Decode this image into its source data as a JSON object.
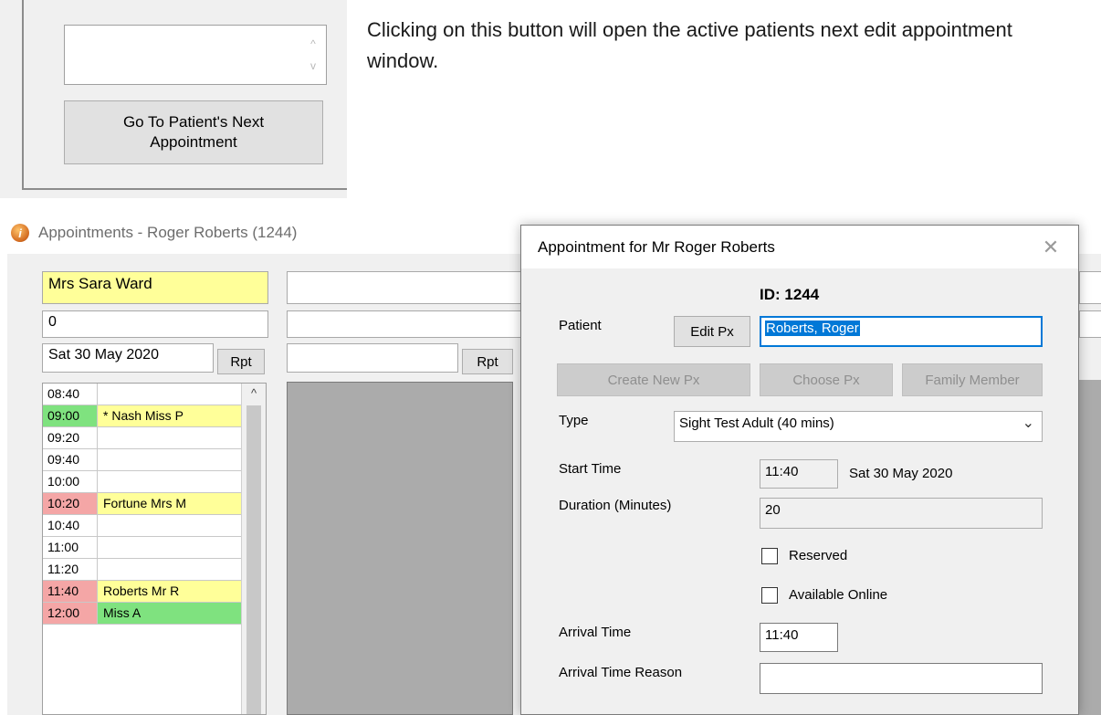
{
  "snippet": {
    "go_to_button_label": "Go To Patient's Next Appointment",
    "explanation": "Clicking on this button will open the active patients next edit appointment window.",
    "scroll_up_glyph": "^",
    "scroll_down_glyph": "v"
  },
  "window": {
    "title": "Appointments - Roger Roberts (1244)",
    "icon": "info-app-icon",
    "icon_glyph": "i"
  },
  "left_panel": {
    "practitioner": "Mrs Sara Ward",
    "count": "0",
    "date": "Sat 30 May 2020",
    "rpt_label": "Rpt"
  },
  "middle_panel": {
    "rpt_label": "Rpt"
  },
  "schedule": {
    "scroll_up_glyph": "^",
    "rows": [
      {
        "time": "08:40",
        "name": "",
        "time_color": "#ffffff",
        "name_color": "#ffffff"
      },
      {
        "time": "09:00",
        "name": "* Nash Miss P",
        "time_color": "#7fe27f",
        "name_color": "#ffff99"
      },
      {
        "time": "09:20",
        "name": "",
        "time_color": "#ffffff",
        "name_color": "#ffffff"
      },
      {
        "time": "09:40",
        "name": "",
        "time_color": "#ffffff",
        "name_color": "#ffffff"
      },
      {
        "time": "10:00",
        "name": "",
        "time_color": "#ffffff",
        "name_color": "#ffffff"
      },
      {
        "time": "10:20",
        "name": "Fortune Mrs M",
        "time_color": "#f4a6a6",
        "name_color": "#ffff99"
      },
      {
        "time": "10:40",
        "name": "",
        "time_color": "#ffffff",
        "name_color": "#ffffff"
      },
      {
        "time": "11:00",
        "name": "",
        "time_color": "#ffffff",
        "name_color": "#ffffff"
      },
      {
        "time": "11:20",
        "name": "",
        "time_color": "#ffffff",
        "name_color": "#ffffff"
      },
      {
        "time": "11:40",
        "name": "Roberts Mr R",
        "time_color": "#f4a6a6",
        "name_color": "#ffff99"
      },
      {
        "time": "12:00",
        "name": "Miss A",
        "time_color": "#f4a6a6",
        "name_color": "#7fe27f"
      }
    ]
  },
  "dialog": {
    "title": "Appointment for Mr Roger Roberts",
    "close_glyph": "✕",
    "id_label": "ID: 1244",
    "patient_label": "Patient",
    "edit_px_label": "Edit Px",
    "patient_value": "Roberts, Roger",
    "create_new_px_label": "Create New Px",
    "choose_px_label": "Choose Px",
    "family_member_label": "Family Member",
    "type_label": "Type",
    "type_value": "Sight Test Adult (40 mins)",
    "type_arrow": "⌄",
    "start_time_label": "Start Time",
    "start_time_value": "11:40",
    "start_date": "Sat 30 May 2020",
    "duration_label": "Duration (Minutes)",
    "duration_value": "20",
    "reserved_label": "Reserved",
    "available_online_label": "Available Online",
    "arrival_time_label": "Arrival Time",
    "arrival_time_value": "11:40",
    "arrival_reason_label": "Arrival Time Reason",
    "arrival_reason_value": ""
  },
  "colors": {
    "accent": "#0078d7",
    "highlight_yellow": "#ffff99",
    "booked_green": "#7fe27f",
    "booked_red": "#f4a6a6",
    "panel_grey": "#ababab"
  }
}
